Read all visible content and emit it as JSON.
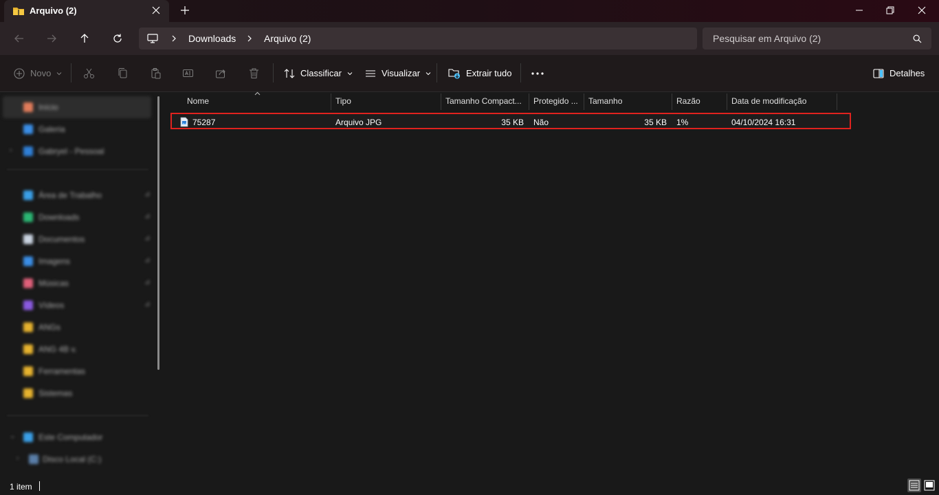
{
  "window": {
    "tab_title": "Arquivo (2)"
  },
  "address": {
    "crumbs": [
      "Downloads",
      "Arquivo (2)"
    ]
  },
  "search": {
    "placeholder": "Pesquisar em Arquivo (2)"
  },
  "commands": {
    "new": "Novo",
    "sort": "Classificar",
    "view": "Visualizar",
    "extract": "Extrair tudo",
    "details": "Detalhes"
  },
  "sidebar": {
    "items": [
      {
        "label": "Início",
        "icon": "home-icon",
        "color": "#e07b5a"
      },
      {
        "label": "Galeria",
        "icon": "gallery-icon",
        "color": "#3a8ee6"
      },
      {
        "label": "Gabryel - Pessoal",
        "icon": "onedrive-icon",
        "color": "#2f7fd6"
      },
      {
        "label": "Área de Trabalho",
        "icon": "desktop-icon",
        "color": "#3aa0e8"
      },
      {
        "label": "Downloads",
        "icon": "download-icon",
        "color": "#2bb673"
      },
      {
        "label": "Documentos",
        "icon": "documents-icon",
        "color": "#c9d3e0"
      },
      {
        "label": "Imagens",
        "icon": "pictures-icon",
        "color": "#3a8ee6"
      },
      {
        "label": "Músicas",
        "icon": "music-icon",
        "color": "#e0607a"
      },
      {
        "label": "Vídeos",
        "icon": "videos-icon",
        "color": "#8a5ae0"
      },
      {
        "label": "ANGs",
        "icon": "folder-icon",
        "color": "#e6b22e"
      },
      {
        "label": "ANG 4B v.",
        "icon": "folder-icon",
        "color": "#e6b22e"
      },
      {
        "label": "Ferramentas",
        "icon": "folder-icon",
        "color": "#e6b22e"
      },
      {
        "label": "Sistemas",
        "icon": "folder-icon",
        "color": "#e6b22e"
      },
      {
        "label": "Este Computador",
        "icon": "computer-icon",
        "color": "#3aa0e8"
      },
      {
        "label": "Disco Local (C:)",
        "icon": "drive-icon",
        "color": "#5a7ea8"
      }
    ]
  },
  "columns": {
    "name": "Nome",
    "type": "Tipo",
    "compressed": "Tamanho Compact...",
    "protected": "Protegido ...",
    "size": "Tamanho",
    "ratio": "Razão",
    "modified": "Data de modificação"
  },
  "files": [
    {
      "name": "75287",
      "type": "Arquivo JPG",
      "compressed": "35 KB",
      "protected": "Não",
      "size": "35 KB",
      "ratio": "1%",
      "modified": "04/10/2024 16:31"
    }
  ],
  "status": {
    "count": "1 item"
  },
  "colors": {
    "highlight_border": "#e0231f",
    "accent": "#4cc2ff"
  }
}
